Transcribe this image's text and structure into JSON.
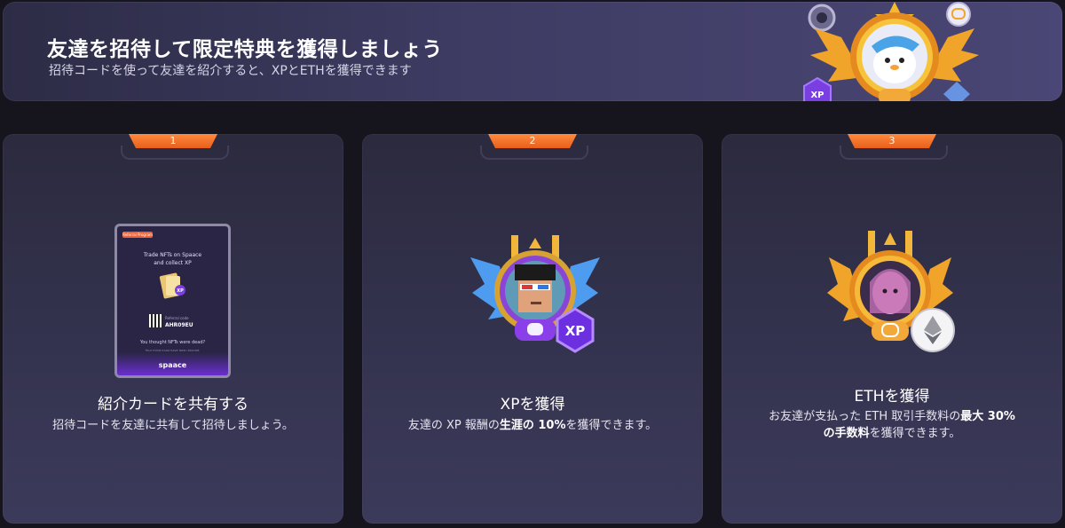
{
  "banner": {
    "title": "友達を招待して限定特典を獲得しましょう",
    "subtitle": "招待コードを使って友達を紹介すると、XPとETHを獲得できます",
    "art_badge": "XP"
  },
  "steps": [
    {
      "number": "1",
      "title": "紹介カードを共有する",
      "description": "招待コードを友達に共有して招待しましょう。",
      "card": {
        "badge": "Referral Program",
        "headline_1": "Trade NFTs on Spaace",
        "headline_2": "and collect XP",
        "xp": "XP",
        "code_label": "Referral code",
        "code": "AHR09EU",
        "tagline": "You thought NFTs were dead?",
        "fine_print": "Your mind must have been blurred.",
        "logo": "spaace"
      }
    },
    {
      "number": "2",
      "title": "XPを獲得",
      "description_pre": "友達の XP 報酬の",
      "description_bold": "生涯の 10%",
      "description_post": "を獲得できます。",
      "badge_text": "XP"
    },
    {
      "number": "3",
      "title": "ETHを獲得",
      "description_line1_pre": "お友達が支払った ETH 取引手数料の",
      "description_line1_bold": "最大 30%",
      "description_line2_bold": "の手数料",
      "description_line2_post": "を獲得できます。"
    }
  ],
  "colors": {
    "accent_orange": "#f07a30",
    "card_bg": "#34334f",
    "page_bg": "#16151d",
    "banner_bg": "#3e3c63"
  }
}
